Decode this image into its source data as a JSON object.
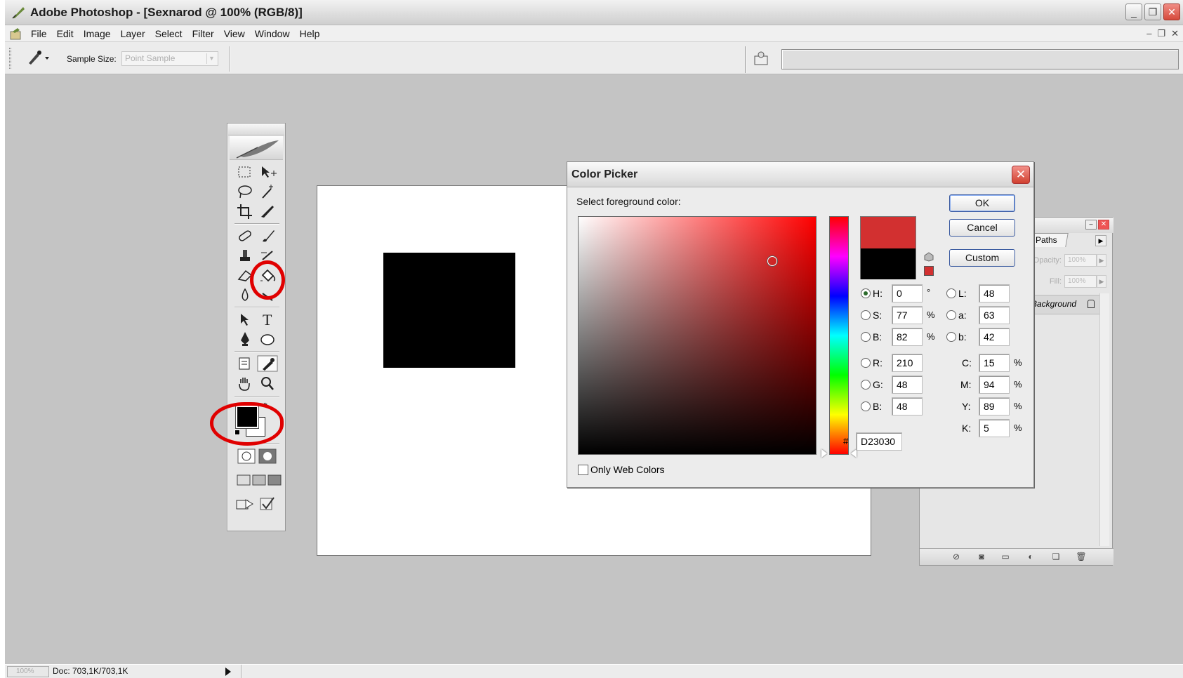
{
  "window": {
    "title": "Adobe Photoshop - [Sexnarod @ 100% (RGB/8)]",
    "buttons": [
      "_",
      "❐",
      "✕"
    ]
  },
  "menubar": {
    "items": [
      "File",
      "Edit",
      "Image",
      "Layer",
      "Select",
      "Filter",
      "View",
      "Window",
      "Help"
    ],
    "doc_buttons": [
      "–",
      "❐",
      "✕"
    ]
  },
  "options": {
    "sample_size_label": "Sample Size:",
    "sample_size_value": "Point Sample"
  },
  "layers_panel": {
    "tab_label": "Paths",
    "opacity_label": "Opacity:",
    "opacity_value": "100%",
    "fill_label": "Fill:",
    "fill_value": "100%",
    "layer_name": "Background"
  },
  "color_picker": {
    "title": "Color Picker",
    "prompt": "Select foreground color:",
    "ok_label": "OK",
    "cancel_label": "Cancel",
    "custom_label": "Custom",
    "hsb": {
      "H": "0",
      "S": "77",
      "B": "82",
      "H_unit": "°",
      "S_unit": "%",
      "B_unit": "%"
    },
    "lab": {
      "L": "48",
      "a": "63",
      "b": "42"
    },
    "rgb": {
      "R": "210",
      "G": "48",
      "B": "48"
    },
    "cmyk": {
      "C": "15",
      "M": "94",
      "Y": "89",
      "K": "5",
      "unit": "%"
    },
    "hex_label": "#",
    "hex": "D23030",
    "web_colors_label": "Only Web Colors",
    "selected_mode": "H",
    "new_color": "#D23030",
    "old_color": "#000000"
  },
  "statusbar": {
    "zoom": "100%",
    "doc_size": "Doc: 703,1K/703,1K"
  },
  "colors": {
    "annotation_circle": "#e00000",
    "accent": "#D23030"
  }
}
